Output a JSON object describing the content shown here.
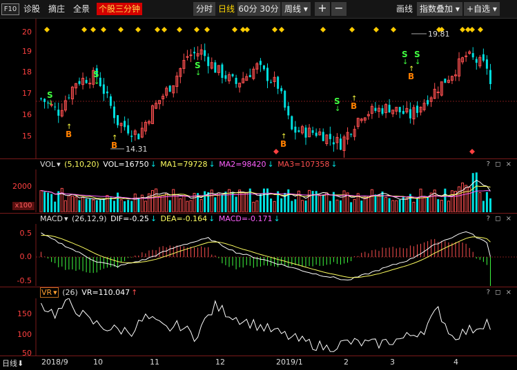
{
  "toolbar": {
    "f10": "F10",
    "left_items": [
      "诊股",
      "摘庄",
      "全景"
    ],
    "active_tab": "个股三分钟",
    "periods": [
      "分时",
      "日线",
      "60分",
      "30分"
    ],
    "active_period": "日线",
    "week_drop": "周线",
    "plus": "+",
    "minus": "−",
    "draw": "画线",
    "overlay": "指数叠加",
    "watchlist": "+自选"
  },
  "main_chart": {
    "y_ticks": [
      "20",
      "19",
      "18",
      "17",
      "16",
      "15"
    ],
    "high_label": "19.81",
    "low_label": "14.31",
    "signal_buy": "B",
    "signal_sell": "S"
  },
  "vol_panel": {
    "name": "VOL",
    "params": "(5,10,20)",
    "vol": "VOL=16750",
    "ma1": "MA1=79728",
    "ma2": "MA2=98420",
    "ma3": "MA3=107358",
    "y_tick": "2000",
    "unit": "x100",
    "controls": "? ◻ ×"
  },
  "macd_panel": {
    "name": "MACD",
    "params": "(26,12,9)",
    "dif": "DIF=-0.25",
    "dea": "DEA=-0.164",
    "macd": "MACD=-0.171",
    "y_ticks": [
      "0.5",
      "0.0",
      "-0.5"
    ],
    "controls": "? ◻ ×"
  },
  "vr_panel": {
    "name": "VR",
    "params": "(26)",
    "value": "VR=110.047",
    "y_ticks": [
      "150",
      "100",
      "50"
    ],
    "controls": "? ◻ ×"
  },
  "x_axis": {
    "period": "日线",
    "labels": [
      "2018/9",
      "10",
      "11",
      "12",
      "2019/1",
      "2",
      "3",
      "4"
    ]
  },
  "colors": {
    "up": "#ff5050",
    "down": "#00e0e0",
    "ma_white": "#ffffff",
    "ma_yellow": "#ffff60",
    "ma_pink": "#ff60ff",
    "accent": "#ffd700"
  },
  "chart_data": {
    "type": "line",
    "x": [
      "2018/9",
      "10",
      "11",
      "12",
      "2019/1",
      "2",
      "3",
      "4"
    ],
    "close_approx": [
      16.6,
      17.6,
      15.8,
      18.9,
      17.6,
      15.3,
      14.8,
      16.3,
      16.9,
      18.6,
      18.9,
      17.4,
      16.6
    ],
    "high": 19.81,
    "low": 14.31,
    "ylim": [
      14.3,
      20.2
    ],
    "series": [
      {
        "name": "VOL",
        "values": [
          16750
        ]
      },
      {
        "name": "MA1",
        "values": [
          79728
        ]
      },
      {
        "name": "MA2",
        "values": [
          98420
        ]
      },
      {
        "name": "MA3",
        "values": [
          107358
        ]
      },
      {
        "name": "DIF",
        "values": [
          -0.25
        ]
      },
      {
        "name": "DEA",
        "values": [
          -0.164
        ]
      },
      {
        "name": "MACD",
        "values": [
          -0.171
        ]
      },
      {
        "name": "VR",
        "values": [
          110.047
        ]
      }
    ]
  }
}
